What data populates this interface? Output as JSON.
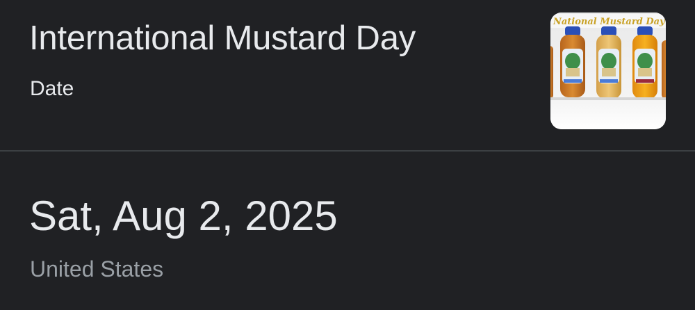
{
  "card": {
    "title": "International Mustard Day",
    "subtitle": "Date",
    "image_icon": "mustard-bottles-photo",
    "image_banner_text": "National Mustard Day"
  },
  "result": {
    "date": "Sat, Aug 2, 2025",
    "region": "United States"
  },
  "colors": {
    "background": "#202124",
    "primary_text": "#e8eaed",
    "secondary_text": "#9aa0a6",
    "divider": "#3c4043"
  }
}
